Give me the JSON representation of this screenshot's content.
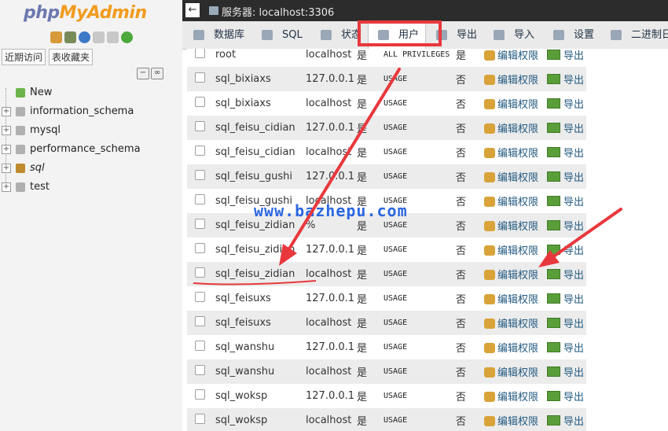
{
  "sidebar": {
    "logo_php": "php",
    "logo_myadmin": "MyAdmin",
    "quick_links": [
      "近期访问",
      "表收藏夹"
    ],
    "tree": [
      {
        "label": "New"
      },
      {
        "label": "information_schema"
      },
      {
        "label": "mysql"
      },
      {
        "label": "performance_schema"
      },
      {
        "label": "sql"
      },
      {
        "label": "test"
      }
    ]
  },
  "topbar": {
    "breadcrumb": "服务器: localhost:3306"
  },
  "tabs": [
    {
      "label": "数据库"
    },
    {
      "label": "SQL"
    },
    {
      "label": "状态"
    },
    {
      "label": "用户"
    },
    {
      "label": "导出"
    },
    {
      "label": "导入"
    },
    {
      "label": "设置"
    },
    {
      "label": "二进制日"
    }
  ],
  "actions": {
    "edit_privileges": "编辑权限",
    "export": "导出"
  },
  "users": [
    {
      "user": "root",
      "host": "localhost",
      "password": "是",
      "privileges": "ALL PRIVILEGES",
      "grant": "是"
    },
    {
      "user": "sql_bixiaxs",
      "host": "127.0.0.1",
      "password": "是",
      "privileges": "USAGE",
      "grant": "否"
    },
    {
      "user": "sql_bixiaxs",
      "host": "localhost",
      "password": "是",
      "privileges": "USAGE",
      "grant": "否"
    },
    {
      "user": "sql_feisu_cidian",
      "host": "127.0.0.1",
      "password": "是",
      "privileges": "USAGE",
      "grant": "否"
    },
    {
      "user": "sql_feisu_cidian",
      "host": "localhost",
      "password": "是",
      "privileges": "USAGE",
      "grant": "否"
    },
    {
      "user": "sql_feisu_gushi",
      "host": "127.0.0.1",
      "password": "是",
      "privileges": "USAGE",
      "grant": "否"
    },
    {
      "user": "sql_feisu_gushi",
      "host": "localhost",
      "password": "是",
      "privileges": "USAGE",
      "grant": "否"
    },
    {
      "user": "sql_feisu_zidian",
      "host": "%",
      "password": "是",
      "privileges": "USAGE",
      "grant": "否"
    },
    {
      "user": "sql_feisu_zidian",
      "host": "127.0.0.1",
      "password": "是",
      "privileges": "USAGE",
      "grant": "否"
    },
    {
      "user": "sql_feisu_zidian",
      "host": "localhost",
      "password": "是",
      "privileges": "USAGE",
      "grant": "否"
    },
    {
      "user": "sql_feisuxs",
      "host": "127.0.0.1",
      "password": "是",
      "privileges": "USAGE",
      "grant": "否"
    },
    {
      "user": "sql_feisuxs",
      "host": "localhost",
      "password": "是",
      "privileges": "USAGE",
      "grant": "否"
    },
    {
      "user": "sql_wanshu",
      "host": "127.0.0.1",
      "password": "是",
      "privileges": "USAGE",
      "grant": "否"
    },
    {
      "user": "sql_wanshu",
      "host": "localhost",
      "password": "是",
      "privileges": "USAGE",
      "grant": "否"
    },
    {
      "user": "sql_woksp",
      "host": "127.0.0.1",
      "password": "是",
      "privileges": "USAGE",
      "grant": "否"
    },
    {
      "user": "sql_woksp",
      "host": "localhost",
      "password": "是",
      "privileges": "USAGE",
      "grant": "否"
    }
  ],
  "watermark": "www.bazhepu.com",
  "colors": {
    "annotation_red": "#e8383d",
    "watermark_blue": "#2a66e0",
    "logo_blue": "#6c78af",
    "logo_orange": "#f29b1d"
  }
}
